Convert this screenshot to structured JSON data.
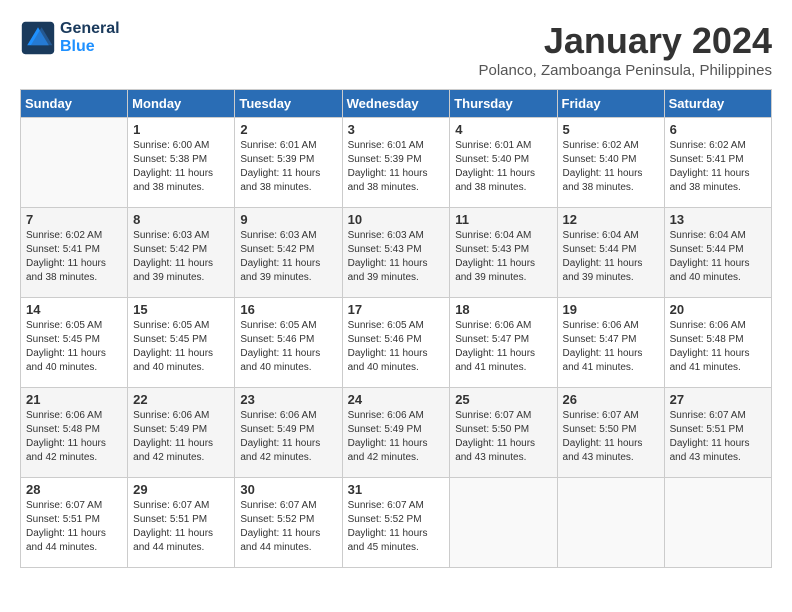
{
  "header": {
    "logo_line1": "General",
    "logo_line2": "Blue",
    "month_title": "January 2024",
    "subtitle": "Polanco, Zamboanga Peninsula, Philippines"
  },
  "weekdays": [
    "Sunday",
    "Monday",
    "Tuesday",
    "Wednesday",
    "Thursday",
    "Friday",
    "Saturday"
  ],
  "weeks": [
    [
      {
        "day": "",
        "sunrise": "",
        "sunset": "",
        "daylight": ""
      },
      {
        "day": "1",
        "sunrise": "Sunrise: 6:00 AM",
        "sunset": "Sunset: 5:38 PM",
        "daylight": "Daylight: 11 hours and 38 minutes."
      },
      {
        "day": "2",
        "sunrise": "Sunrise: 6:01 AM",
        "sunset": "Sunset: 5:39 PM",
        "daylight": "Daylight: 11 hours and 38 minutes."
      },
      {
        "day": "3",
        "sunrise": "Sunrise: 6:01 AM",
        "sunset": "Sunset: 5:39 PM",
        "daylight": "Daylight: 11 hours and 38 minutes."
      },
      {
        "day": "4",
        "sunrise": "Sunrise: 6:01 AM",
        "sunset": "Sunset: 5:40 PM",
        "daylight": "Daylight: 11 hours and 38 minutes."
      },
      {
        "day": "5",
        "sunrise": "Sunrise: 6:02 AM",
        "sunset": "Sunset: 5:40 PM",
        "daylight": "Daylight: 11 hours and 38 minutes."
      },
      {
        "day": "6",
        "sunrise": "Sunrise: 6:02 AM",
        "sunset": "Sunset: 5:41 PM",
        "daylight": "Daylight: 11 hours and 38 minutes."
      }
    ],
    [
      {
        "day": "7",
        "sunrise": "Sunrise: 6:02 AM",
        "sunset": "Sunset: 5:41 PM",
        "daylight": "Daylight: 11 hours and 38 minutes."
      },
      {
        "day": "8",
        "sunrise": "Sunrise: 6:03 AM",
        "sunset": "Sunset: 5:42 PM",
        "daylight": "Daylight: 11 hours and 39 minutes."
      },
      {
        "day": "9",
        "sunrise": "Sunrise: 6:03 AM",
        "sunset": "Sunset: 5:42 PM",
        "daylight": "Daylight: 11 hours and 39 minutes."
      },
      {
        "day": "10",
        "sunrise": "Sunrise: 6:03 AM",
        "sunset": "Sunset: 5:43 PM",
        "daylight": "Daylight: 11 hours and 39 minutes."
      },
      {
        "day": "11",
        "sunrise": "Sunrise: 6:04 AM",
        "sunset": "Sunset: 5:43 PM",
        "daylight": "Daylight: 11 hours and 39 minutes."
      },
      {
        "day": "12",
        "sunrise": "Sunrise: 6:04 AM",
        "sunset": "Sunset: 5:44 PM",
        "daylight": "Daylight: 11 hours and 39 minutes."
      },
      {
        "day": "13",
        "sunrise": "Sunrise: 6:04 AM",
        "sunset": "Sunset: 5:44 PM",
        "daylight": "Daylight: 11 hours and 40 minutes."
      }
    ],
    [
      {
        "day": "14",
        "sunrise": "Sunrise: 6:05 AM",
        "sunset": "Sunset: 5:45 PM",
        "daylight": "Daylight: 11 hours and 40 minutes."
      },
      {
        "day": "15",
        "sunrise": "Sunrise: 6:05 AM",
        "sunset": "Sunset: 5:45 PM",
        "daylight": "Daylight: 11 hours and 40 minutes."
      },
      {
        "day": "16",
        "sunrise": "Sunrise: 6:05 AM",
        "sunset": "Sunset: 5:46 PM",
        "daylight": "Daylight: 11 hours and 40 minutes."
      },
      {
        "day": "17",
        "sunrise": "Sunrise: 6:05 AM",
        "sunset": "Sunset: 5:46 PM",
        "daylight": "Daylight: 11 hours and 40 minutes."
      },
      {
        "day": "18",
        "sunrise": "Sunrise: 6:06 AM",
        "sunset": "Sunset: 5:47 PM",
        "daylight": "Daylight: 11 hours and 41 minutes."
      },
      {
        "day": "19",
        "sunrise": "Sunrise: 6:06 AM",
        "sunset": "Sunset: 5:47 PM",
        "daylight": "Daylight: 11 hours and 41 minutes."
      },
      {
        "day": "20",
        "sunrise": "Sunrise: 6:06 AM",
        "sunset": "Sunset: 5:48 PM",
        "daylight": "Daylight: 11 hours and 41 minutes."
      }
    ],
    [
      {
        "day": "21",
        "sunrise": "Sunrise: 6:06 AM",
        "sunset": "Sunset: 5:48 PM",
        "daylight": "Daylight: 11 hours and 42 minutes."
      },
      {
        "day": "22",
        "sunrise": "Sunrise: 6:06 AM",
        "sunset": "Sunset: 5:49 PM",
        "daylight": "Daylight: 11 hours and 42 minutes."
      },
      {
        "day": "23",
        "sunrise": "Sunrise: 6:06 AM",
        "sunset": "Sunset: 5:49 PM",
        "daylight": "Daylight: 11 hours and 42 minutes."
      },
      {
        "day": "24",
        "sunrise": "Sunrise: 6:06 AM",
        "sunset": "Sunset: 5:49 PM",
        "daylight": "Daylight: 11 hours and 42 minutes."
      },
      {
        "day": "25",
        "sunrise": "Sunrise: 6:07 AM",
        "sunset": "Sunset: 5:50 PM",
        "daylight": "Daylight: 11 hours and 43 minutes."
      },
      {
        "day": "26",
        "sunrise": "Sunrise: 6:07 AM",
        "sunset": "Sunset: 5:50 PM",
        "daylight": "Daylight: 11 hours and 43 minutes."
      },
      {
        "day": "27",
        "sunrise": "Sunrise: 6:07 AM",
        "sunset": "Sunset: 5:51 PM",
        "daylight": "Daylight: 11 hours and 43 minutes."
      }
    ],
    [
      {
        "day": "28",
        "sunrise": "Sunrise: 6:07 AM",
        "sunset": "Sunset: 5:51 PM",
        "daylight": "Daylight: 11 hours and 44 minutes."
      },
      {
        "day": "29",
        "sunrise": "Sunrise: 6:07 AM",
        "sunset": "Sunset: 5:51 PM",
        "daylight": "Daylight: 11 hours and 44 minutes."
      },
      {
        "day": "30",
        "sunrise": "Sunrise: 6:07 AM",
        "sunset": "Sunset: 5:52 PM",
        "daylight": "Daylight: 11 hours and 44 minutes."
      },
      {
        "day": "31",
        "sunrise": "Sunrise: 6:07 AM",
        "sunset": "Sunset: 5:52 PM",
        "daylight": "Daylight: 11 hours and 45 minutes."
      },
      {
        "day": "",
        "sunrise": "",
        "sunset": "",
        "daylight": ""
      },
      {
        "day": "",
        "sunrise": "",
        "sunset": "",
        "daylight": ""
      },
      {
        "day": "",
        "sunrise": "",
        "sunset": "",
        "daylight": ""
      }
    ]
  ]
}
